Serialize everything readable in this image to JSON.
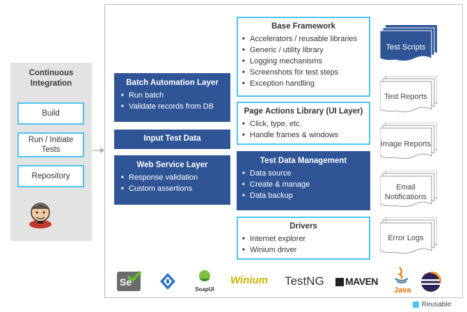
{
  "ci": {
    "title": "Continuous Integration",
    "items": [
      "Build",
      "Run / Initiate Tests",
      "Repository"
    ],
    "logo_icon": "jenkins-butler-icon"
  },
  "left_column": {
    "batch": {
      "title": "Batch Automation Layer",
      "bullets": [
        "Run batch",
        "Validate records from DB"
      ]
    },
    "input": {
      "title": "Input Test Data"
    },
    "webservice": {
      "title": "Web Service Layer",
      "bullets": [
        "Response validation",
        "Custom assertions"
      ]
    }
  },
  "center_column": {
    "base": {
      "title": "Base Framework",
      "bullets": [
        "Accelerators / reusable libraries",
        "Generic / utility library",
        "Logging mechanisms",
        "Screenshots for test steps",
        "Exception handling"
      ]
    },
    "page_actions": {
      "title": "Page Actions Library (UI Layer)",
      "bullets": [
        "Click, type, etc.",
        "Handle frames & windows"
      ]
    },
    "tdm": {
      "title": "Test Data Management",
      "bullets": [
        "Data source",
        "Create & manage",
        "Data backup"
      ]
    },
    "drivers": {
      "title": "Drivers",
      "bullets": [
        "Internet explorer",
        "Winium driver"
      ]
    }
  },
  "outputs": [
    "Test Scripts",
    "Test Reports",
    "Image Reports",
    "Email Notifications",
    "Error Logs"
  ],
  "tools": {
    "selenium": "Se",
    "soapui": "SoapUI",
    "winium": "Winium",
    "testng": "TestNG",
    "maven": "MAVEN",
    "java": "Java"
  },
  "legend": {
    "label": "Reusable",
    "color": "#4cc3f0"
  },
  "colors": {
    "dark_box": "#2f5597",
    "accent": "#4cc3f0",
    "ci_bg": "#e3e3e3"
  }
}
